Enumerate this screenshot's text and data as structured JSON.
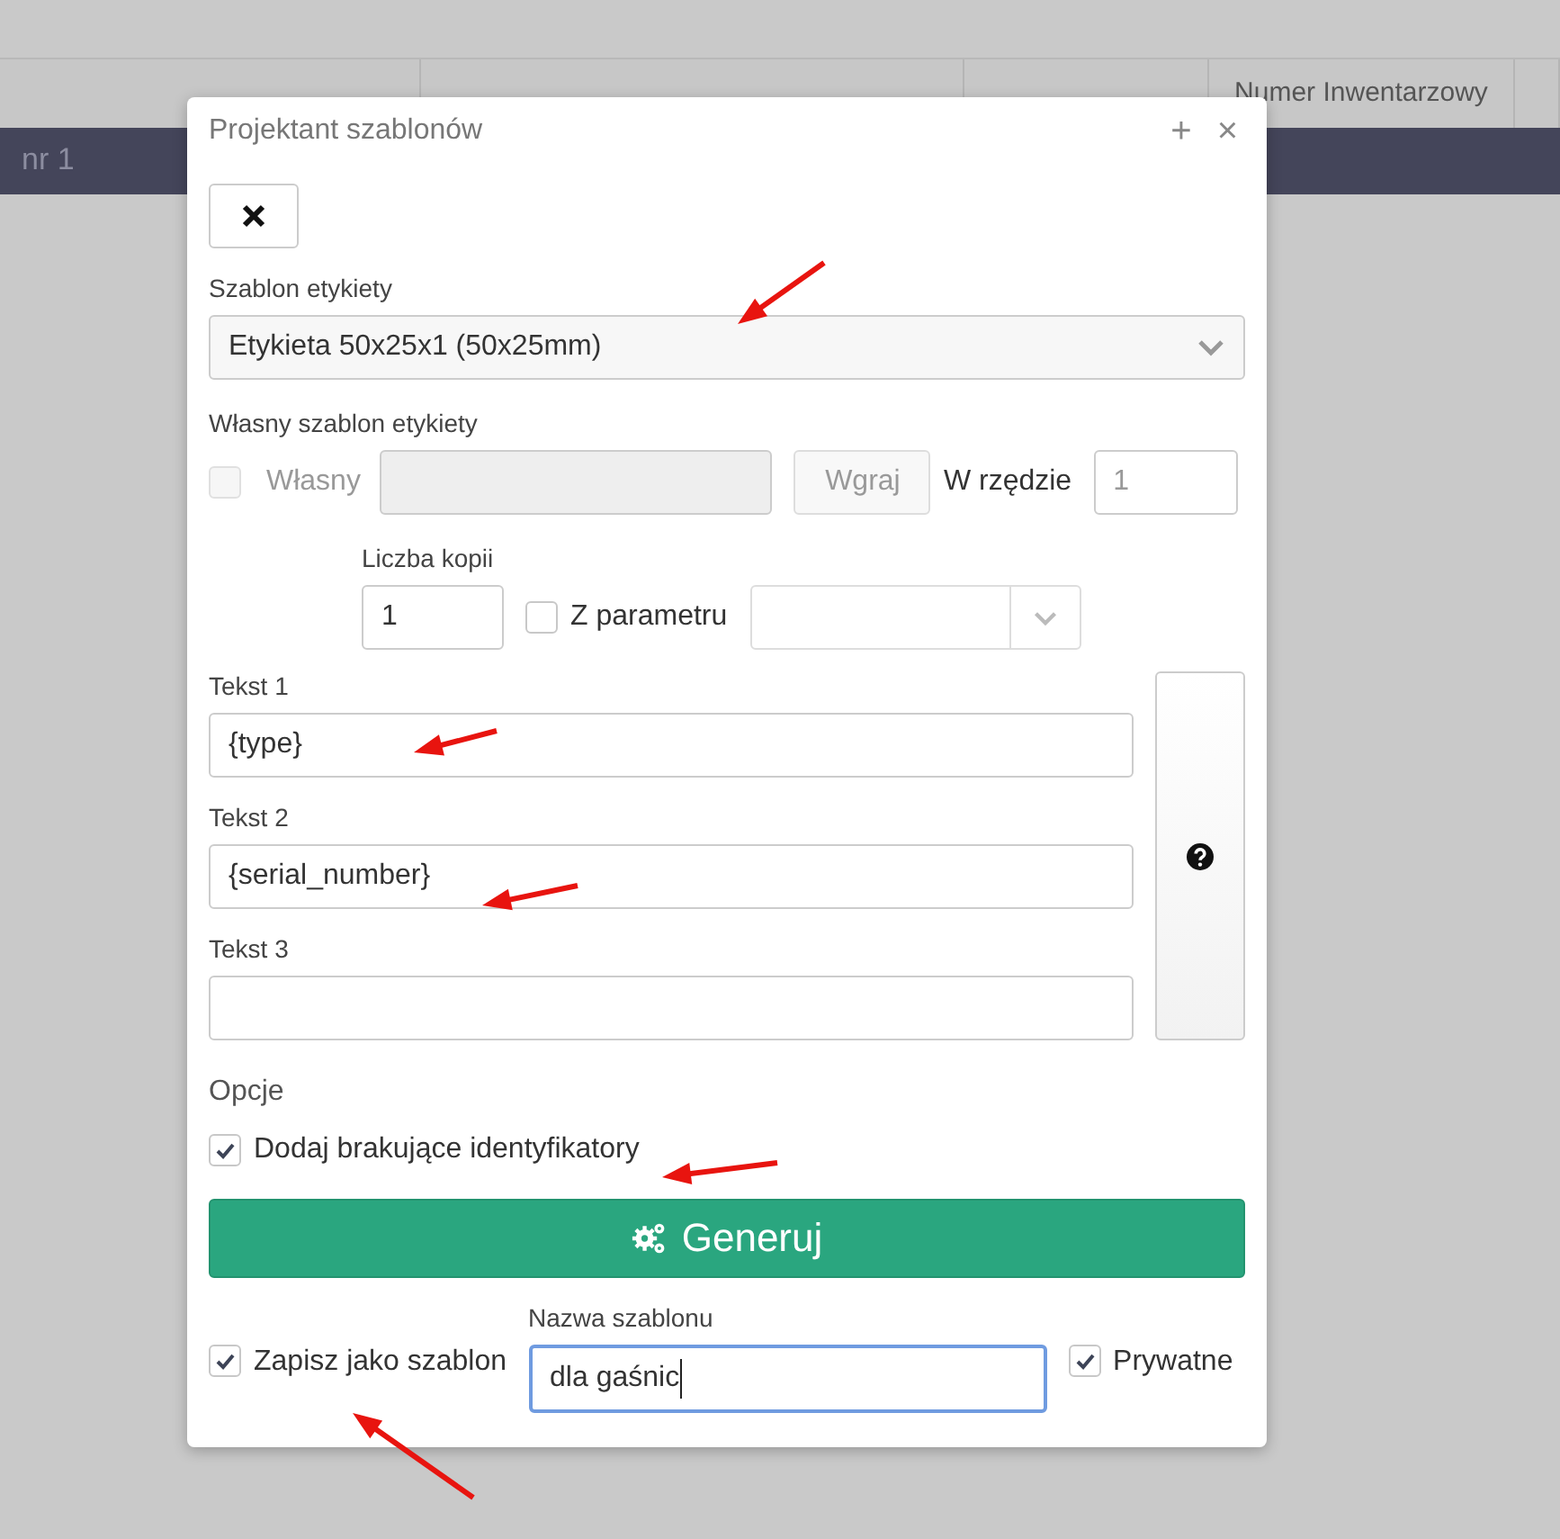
{
  "background": {
    "column_header": "Numer Inwentarzowy",
    "row_cell": "nr 1"
  },
  "window": {
    "title": "Projektant szablonów",
    "controls": [
      "+",
      "×"
    ]
  },
  "template": {
    "label": "Szablon etykiety",
    "value": "Etykieta 50x25x1 (50x25mm)"
  },
  "custom": {
    "label": "Własny szablon etykiety",
    "checkbox": {
      "label": "Własny",
      "checked": false,
      "disabled": true
    },
    "upload_button": {
      "label": "Wgraj",
      "disabled": true
    },
    "per_row": {
      "label": "W rzędzie",
      "value": "1",
      "disabled": true
    }
  },
  "copies": {
    "label": "Liczba kopii",
    "value": "1",
    "from_param": {
      "label": "Z parametru",
      "checked": false
    }
  },
  "texts": [
    {
      "label": "Tekst 1",
      "value": "{type}"
    },
    {
      "label": "Tekst 2",
      "value": "{serial_number}"
    },
    {
      "label": "Tekst 3"
    }
  ],
  "options": {
    "label": "Opcje",
    "items": [
      {
        "label": "Dodaj brakujące identyfikatory",
        "checked": true
      }
    ]
  },
  "generate": {
    "label": "Generuj"
  },
  "save": {
    "checkbox": {
      "label": "Zapisz jako szablon",
      "checked": true
    },
    "name": {
      "label": "Nazwa szablonu",
      "value": "dla gaśnic",
      "focused": true
    },
    "private": {
      "label": "Prywatne",
      "checked": true
    }
  }
}
